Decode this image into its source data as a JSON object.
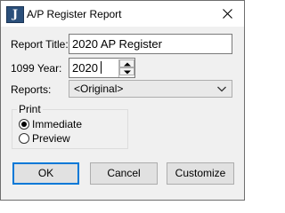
{
  "window": {
    "title": "A/P Register Report",
    "icon_letter": "J"
  },
  "form": {
    "report_title_label": "Report Title:",
    "report_title_value": "2020 AP Register",
    "year_label": "1099 Year:",
    "year_value": "2020",
    "reports_label": "Reports:",
    "reports_value": "<Original>"
  },
  "print_group": {
    "title": "Print",
    "options": [
      {
        "label": "Immediate",
        "selected": true
      },
      {
        "label": "Preview",
        "selected": false
      }
    ]
  },
  "buttons": {
    "ok": "OK",
    "cancel": "Cancel",
    "customize": "Customize"
  },
  "icons": {
    "app": "app-icon",
    "close": "close-icon",
    "spin_up": "chevron-up-icon",
    "spin_down": "chevron-down-icon",
    "combo": "chevron-down-icon"
  },
  "colors": {
    "accent": "#0078d7",
    "dialog_bg": "#f0f0f0",
    "app_icon": "#2a4f7a"
  }
}
